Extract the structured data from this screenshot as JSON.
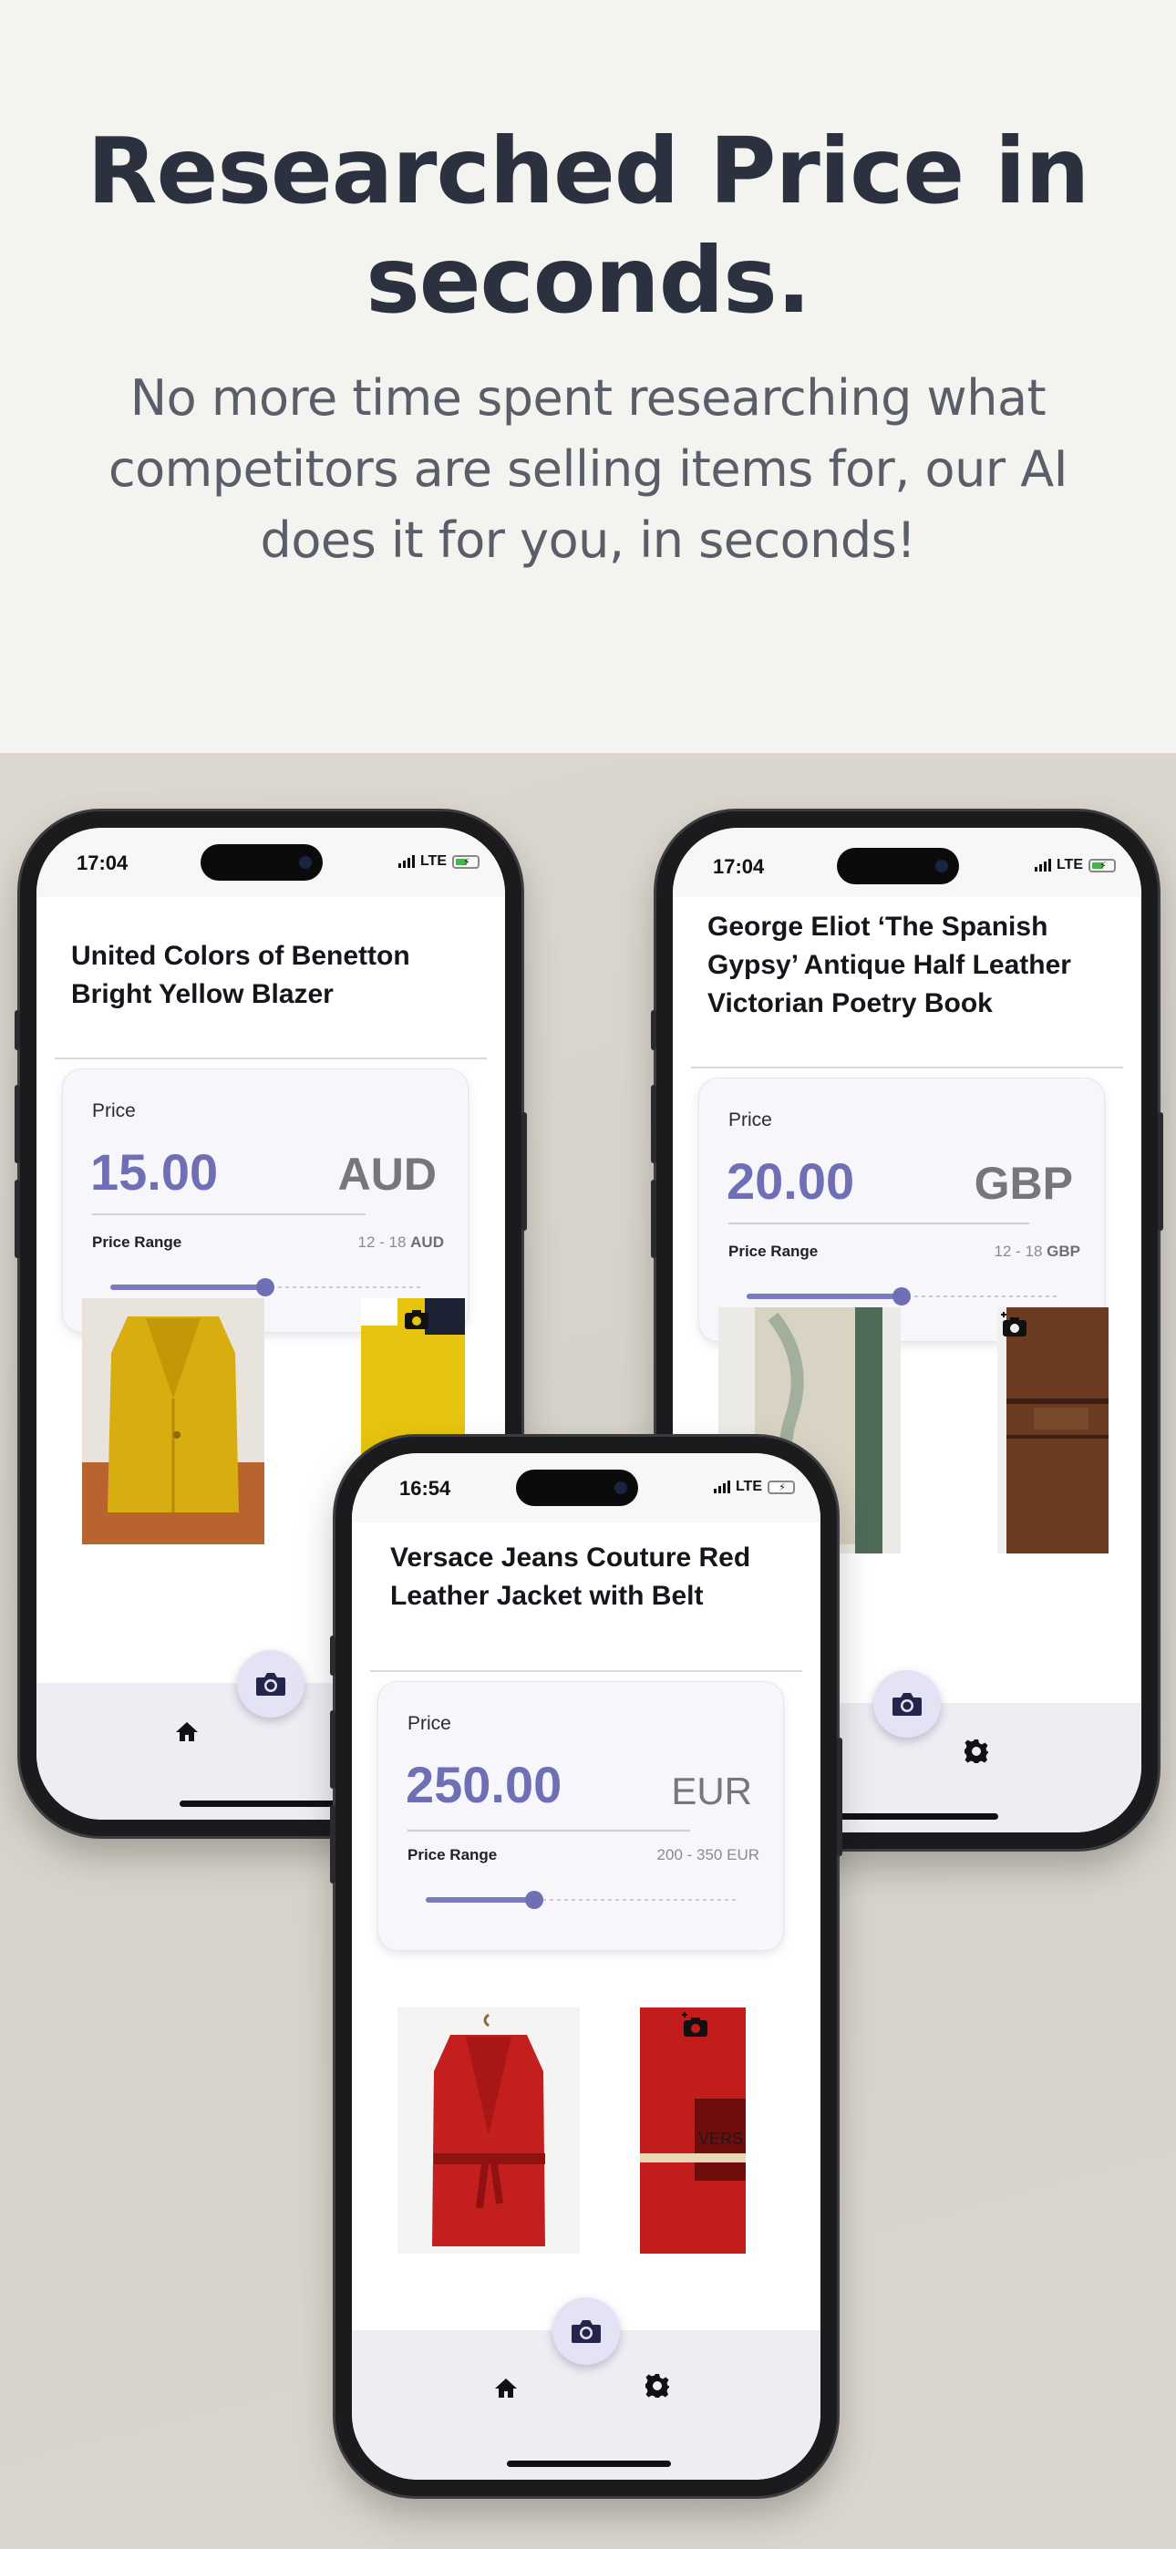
{
  "header": {
    "headline": "Researched Price in seconds.",
    "subline": "No more time spent researching what competitors are selling items for, our AI does it for you, in seconds!"
  },
  "phones": [
    {
      "time": "17:04",
      "network": "LTE",
      "title": "United Colors of Benetton Bright Yellow Blazer",
      "price_label": "Price",
      "price": "15.00",
      "currency": "AUD",
      "range_label": "Price Range",
      "range": "12 - 18",
      "range_currency": "AUD",
      "slider_fraction": 0.5
    },
    {
      "time": "17:04",
      "network": "LTE",
      "title": "George Eliot ‘The Spanish Gypsy’ Antique Half Leather Victorian Poetry Book",
      "price_label": "Price",
      "price": "20.00",
      "currency": "GBP",
      "range_label": "Price Range",
      "range": "12 - 18",
      "range_currency": "GBP",
      "slider_fraction": 0.5
    },
    {
      "time": "16:54",
      "network": "LTE",
      "title": "Versace Jeans Couture Red Leather Jacket with Belt",
      "price_label": "Price",
      "price": "250.00",
      "currency": "EUR",
      "range_label": "Price Range",
      "range": "200 - 350 EUR",
      "range_currency": "",
      "slider_fraction": 0.35
    }
  ],
  "icons": {
    "camera": "camera-icon",
    "home": "home-icon",
    "settings": "gear-icon",
    "add_photo": "add-photo-icon"
  },
  "colors": {
    "accent": "#6f6fb6",
    "headline": "#2c3140",
    "tabbar": "#eeedf3"
  }
}
